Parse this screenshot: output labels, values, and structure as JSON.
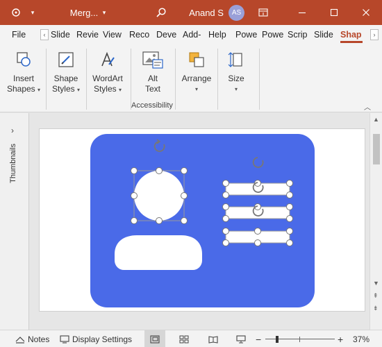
{
  "titlebar": {
    "doc_title": "Merg...",
    "user_name": "Anand S",
    "user_initials": "AS",
    "bg_color": "#b7472a"
  },
  "tabs": [
    "File",
    "Slide",
    "Revie",
    "View",
    "Reco",
    "Deve",
    "Add-",
    "Help",
    "Powe",
    "Powe",
    "Scrip",
    "Slide",
    "Shap"
  ],
  "active_tab": "Shap",
  "ribbon": {
    "insert_shapes": {
      "line1": "Insert",
      "line2": "Shapes"
    },
    "shape_styles": {
      "line1": "Shape",
      "line2": "Styles"
    },
    "wordart_styles": {
      "line1": "WordArt",
      "line2": "Styles"
    },
    "alt_text": {
      "line1": "Alt",
      "line2": "Text"
    },
    "accessibility_label": "Accessibility",
    "arrange": {
      "line1": "Arrange"
    },
    "size": {
      "line1": "Size"
    }
  },
  "thumbnails_label": "Thumbnails",
  "slide": {
    "card_color": "#4a6ae8"
  },
  "statusbar": {
    "notes_label": "Notes",
    "display_settings_label": "Display Settings",
    "zoom_level": "37%",
    "zoom_fraction": 0.37
  }
}
